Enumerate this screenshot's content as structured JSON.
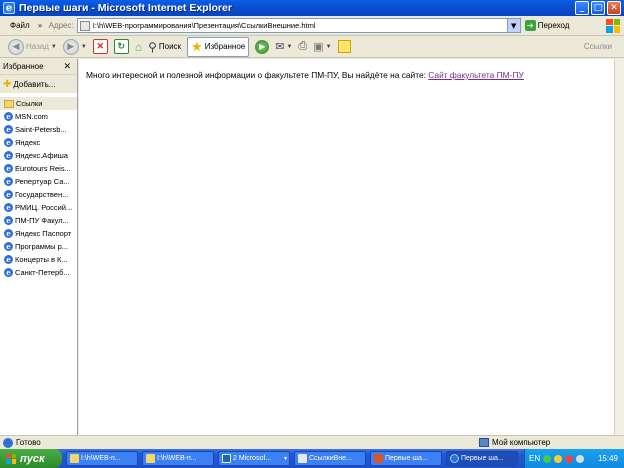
{
  "window": {
    "title": "Первые шаги - Microsoft Internet Explorer",
    "minimize": "_",
    "maximize": "□",
    "close": "✕"
  },
  "menu": {
    "file": "Файл",
    "more": "»",
    "address_label": "Адрес:",
    "address_value": "I:\\h\\WEB-программирования\\Презентация\\СсылкиВнешние.html",
    "go_label": "Переход"
  },
  "toolbar": {
    "back": "Назад",
    "search": "Поиск",
    "favorites": "Избранное",
    "links": "Ссылки"
  },
  "favorites_pane": {
    "title": "Избранное",
    "add": "Добавить...",
    "items": [
      {
        "label": "Ссылки",
        "type": "folder"
      },
      {
        "label": "MSN.com",
        "type": "link"
      },
      {
        "label": "Saint-Petersb...",
        "type": "link"
      },
      {
        "label": "Яндекс",
        "type": "link"
      },
      {
        "label": "Яндекс.Афиша",
        "type": "link"
      },
      {
        "label": "Eurotours Reis...",
        "type": "link"
      },
      {
        "label": "Репертуар Са...",
        "type": "link"
      },
      {
        "label": "Государствен...",
        "type": "link"
      },
      {
        "label": "РМИЦ. Россий...",
        "type": "link"
      },
      {
        "label": "ПМ-ПУ  Факул...",
        "type": "link"
      },
      {
        "label": "Яндекс Паспорт",
        "type": "link"
      },
      {
        "label": "Программы р...",
        "type": "link"
      },
      {
        "label": "Концерты в К...",
        "type": "link"
      },
      {
        "label": "Санкт-Петерб...",
        "type": "link"
      }
    ]
  },
  "content": {
    "text": "Много интересной и полезной информации о факультете ПМ-ПУ, Вы найдёте на сайте: ",
    "link": "Сайт факультета ПМ-ПУ"
  },
  "status": {
    "left": "Готово",
    "zone": "Мой компьютер"
  },
  "taskbar": {
    "start": "пуск",
    "buttons": [
      {
        "label": "I:\\h\\WEB-п...",
        "icon": "folder"
      },
      {
        "label": "I:\\h\\WEB-п...",
        "icon": "folder"
      },
      {
        "label": "2 Microsof...",
        "icon": "word",
        "count": "▾"
      },
      {
        "label": "СсылкиВне...",
        "icon": "doc"
      },
      {
        "label": "Первые ша...",
        "icon": "ppt"
      },
      {
        "label": "Первые ша...",
        "icon": "ie"
      }
    ],
    "lang": "EN",
    "clock": "15:49"
  }
}
